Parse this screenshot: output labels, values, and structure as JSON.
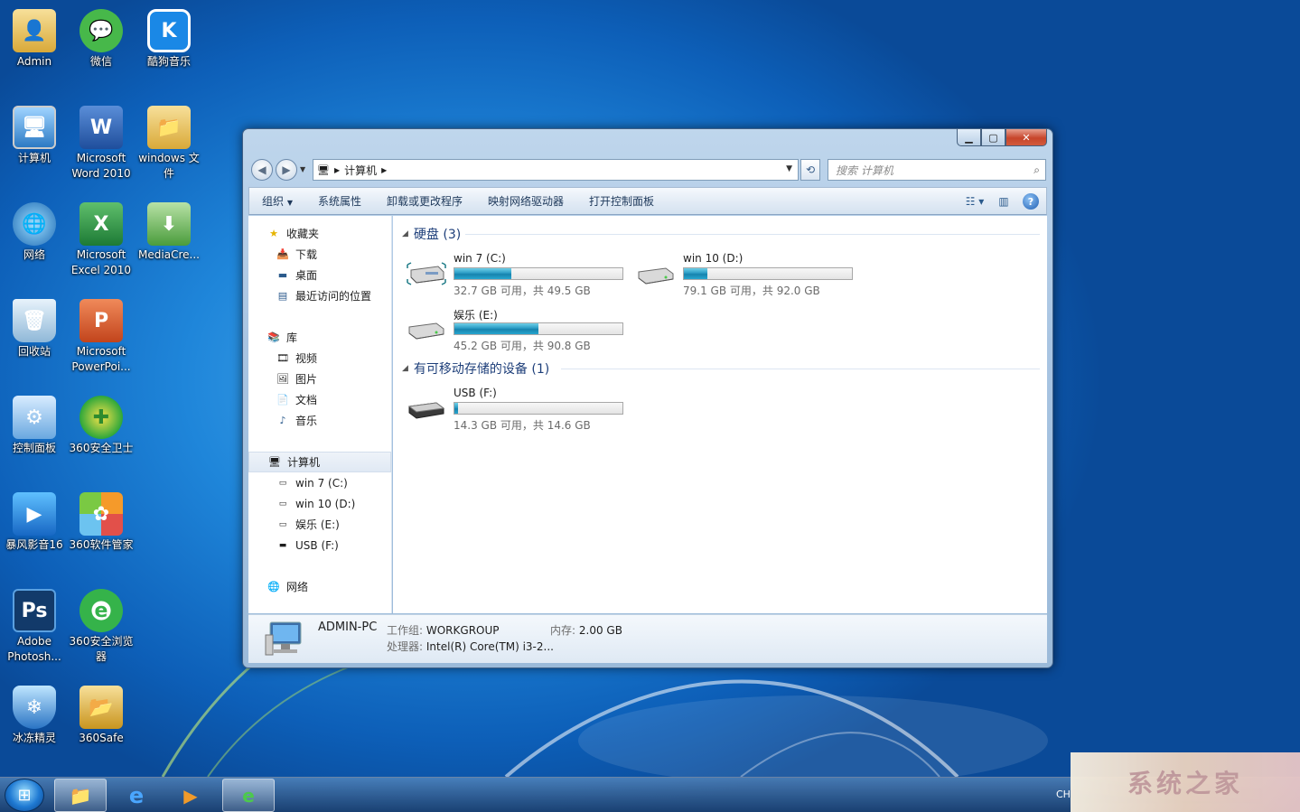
{
  "desktop": {
    "icons": [
      {
        "label": "Admin",
        "icon": "user-folder-icon"
      },
      {
        "label": "微信",
        "icon": "wechat-icon"
      },
      {
        "label": "酷狗音乐",
        "icon": "kugou-icon"
      },
      {
        "label": "计算机",
        "icon": "computer-icon"
      },
      {
        "label": "Microsoft Word 2010",
        "icon": "word-icon"
      },
      {
        "label": "windows 文件",
        "icon": "folder-icon"
      },
      {
        "label": "网络",
        "icon": "network-icon"
      },
      {
        "label": "Microsoft Excel 2010",
        "icon": "excel-icon"
      },
      {
        "label": "MediaCre...",
        "icon": "media-creation-icon"
      },
      {
        "label": "回收站",
        "icon": "recycle-bin-icon"
      },
      {
        "label": "Microsoft PowerPoi...",
        "icon": "powerpoint-icon"
      },
      {
        "label": "控制面板",
        "icon": "control-panel-icon"
      },
      {
        "label": "360安全卫士",
        "icon": "360-safe-guard-icon"
      },
      {
        "label": "暴风影音16",
        "icon": "baofeng-player-icon"
      },
      {
        "label": "360软件管家",
        "icon": "360-software-manager-icon"
      },
      {
        "label": "Adobe Photosh...",
        "icon": "photoshop-icon"
      },
      {
        "label": "360安全浏览器",
        "icon": "360-browser-icon"
      },
      {
        "label": "冰冻精灵",
        "icon": "freeze-shield-icon"
      },
      {
        "label": "360Safe",
        "icon": "360safe-folder-icon"
      }
    ]
  },
  "window": {
    "address": {
      "root_icon": "computer-icon",
      "path": "计算机"
    },
    "search_placeholder": "搜索 计算机",
    "toolbar": {
      "organize": "组织",
      "system_properties": "系统属性",
      "uninstall": "卸载或更改程序",
      "map_drive": "映射网络驱动器",
      "control_panel": "打开控制面板"
    },
    "nav": {
      "favorites": "收藏夹",
      "downloads": "下载",
      "desktop": "桌面",
      "recent": "最近访问的位置",
      "libraries": "库",
      "videos": "视频",
      "pictures": "图片",
      "documents": "文档",
      "music": "音乐",
      "computer": "计算机",
      "drive_c": "win 7  (C:)",
      "drive_d": "win 10 (D:)",
      "drive_e": "娱乐 (E:)",
      "drive_f": "USB (F:)",
      "network": "网络"
    },
    "groups": {
      "hard_disks": "硬盘 (3)",
      "removable": "有可移动存储的设备 (1)"
    },
    "drives": [
      {
        "name": "win 7  (C:)",
        "info": "32.7 GB 可用，共 49.5 GB",
        "used_fraction": 0.34
      },
      {
        "name": "win 10 (D:)",
        "info": "79.1 GB 可用，共 92.0 GB",
        "used_fraction": 0.14
      },
      {
        "name": "娱乐 (E:)",
        "info": "45.2 GB 可用，共 90.8 GB",
        "used_fraction": 0.5
      },
      {
        "name": "USB (F:)",
        "info": "14.3 GB 可用，共 14.6 GB",
        "used_fraction": 0.02
      }
    ],
    "details": {
      "pc_name": "ADMIN-PC",
      "workgroup_label": "工作组:",
      "workgroup": "WORKGROUP",
      "memory_label": "内存:",
      "memory": "2.00 GB",
      "cpu_label": "处理器:",
      "cpu": "Intel(R) Core(TM) i3-2..."
    }
  },
  "taskbar": {
    "ime": "CH",
    "buttons": [
      "explorer",
      "internet-explorer",
      "media-player",
      "360-browser"
    ]
  },
  "watermark": "系统之家"
}
